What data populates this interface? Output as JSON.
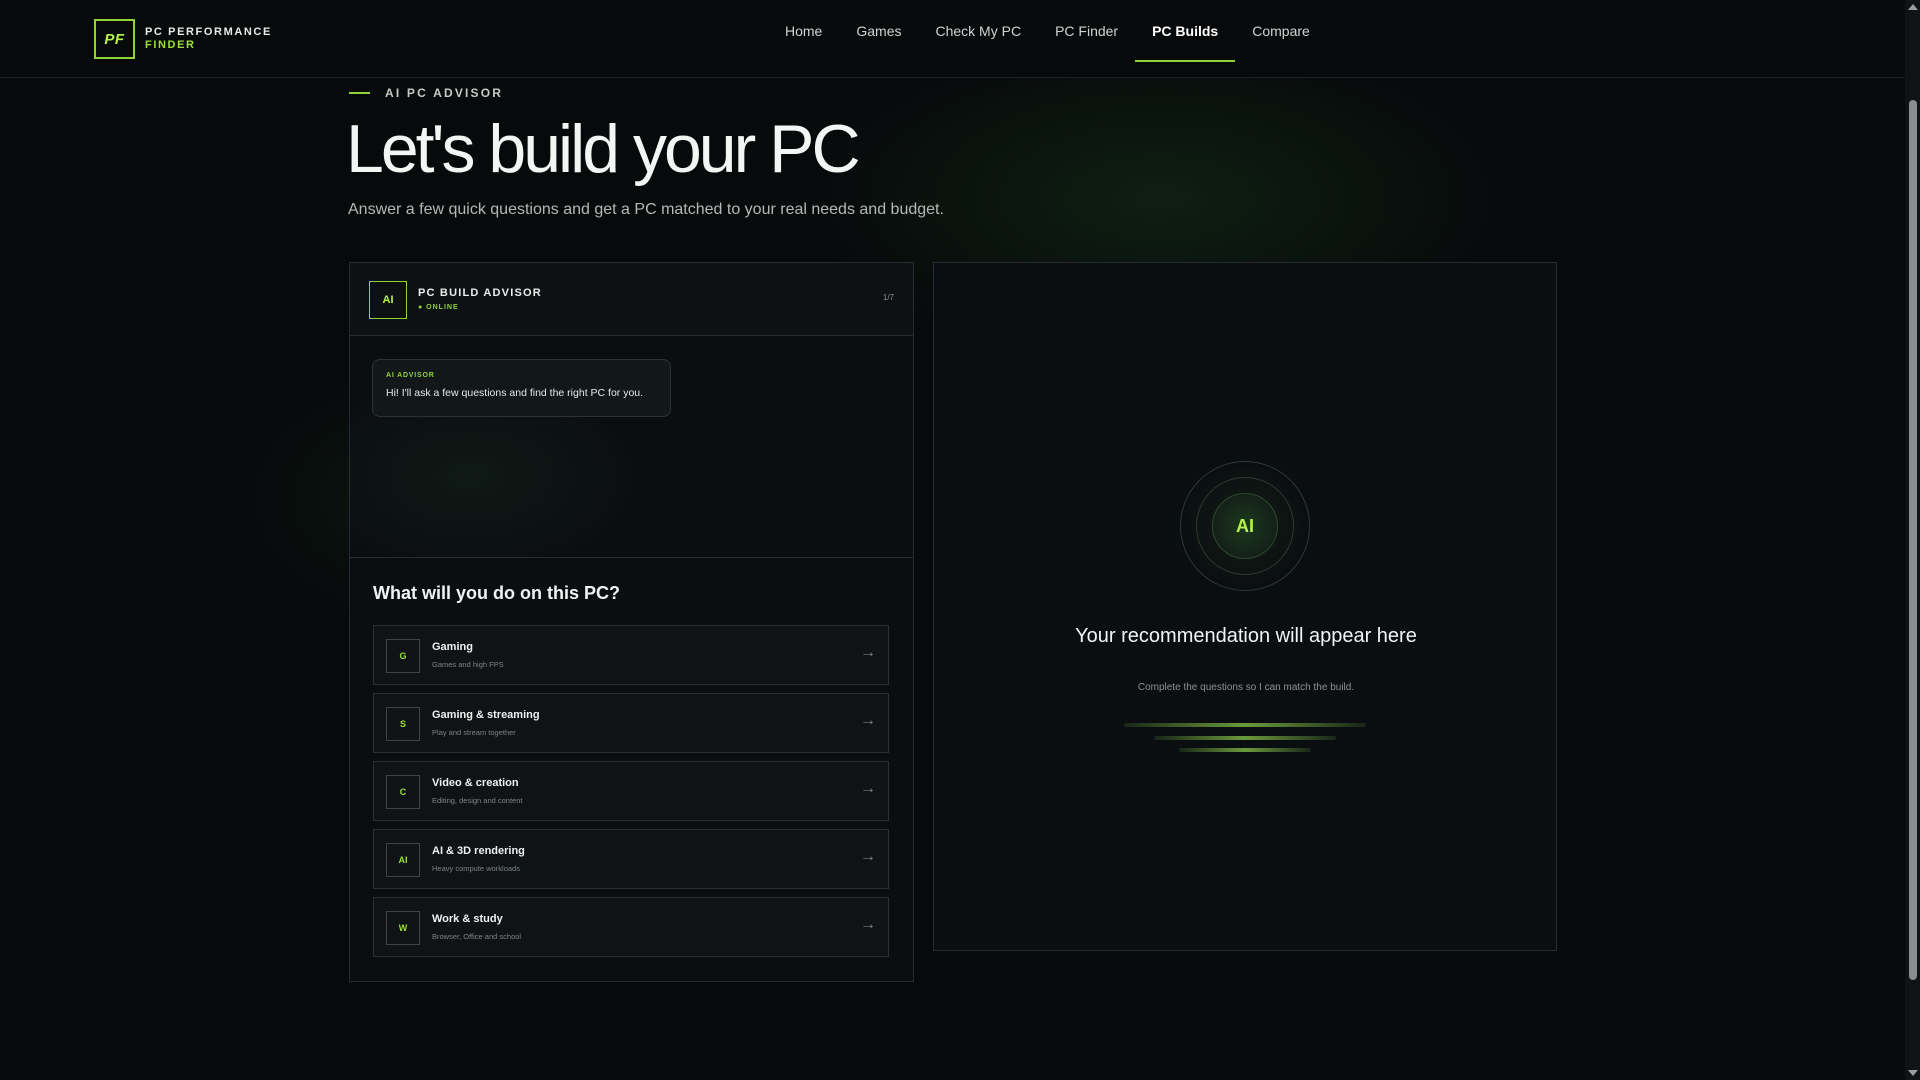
{
  "brand": {
    "logo_mark": "PF",
    "name_line1": "PC PERFORMANCE",
    "name_line2": "FINDER",
    "accent_color": "#8fd33a"
  },
  "nav": {
    "items": [
      {
        "label": "Home",
        "active": false
      },
      {
        "label": "Games",
        "active": false
      },
      {
        "label": "Check My PC",
        "active": false
      },
      {
        "label": "PC Finder",
        "active": false
      },
      {
        "label": "PC Builds",
        "active": true
      },
      {
        "label": "Compare",
        "active": false
      }
    ]
  },
  "hero": {
    "eyebrow": "AI PC ADVISOR",
    "title": "Let's build your PC",
    "subtitle": "Answer a few quick questions and get a PC matched to your real needs and budget."
  },
  "advisor": {
    "badge": "AI",
    "title": "PC BUILD ADVISOR",
    "status": "● ONLINE",
    "step": "1/7",
    "message": {
      "label": "AI ADVISOR",
      "text": "Hi! I'll ask a few questions and find the right PC for you."
    },
    "question": "What will you do on this PC?",
    "options": [
      {
        "icon": "G",
        "title": "Gaming",
        "desc": "Games and high FPS"
      },
      {
        "icon": "S",
        "title": "Gaming & streaming",
        "desc": "Play and stream together"
      },
      {
        "icon": "C",
        "title": "Video & creation",
        "desc": "Editing, design and content"
      },
      {
        "icon": "AI",
        "title": "AI & 3D rendering",
        "desc": "Heavy compute workloads"
      },
      {
        "icon": "W",
        "title": "Work & study",
        "desc": "Browser, Office and school"
      }
    ],
    "arrow": "→"
  },
  "recommendation": {
    "badge": "AI",
    "title": "Your recommendation will appear here",
    "subtitle": "Complete the questions so I can match the build."
  }
}
